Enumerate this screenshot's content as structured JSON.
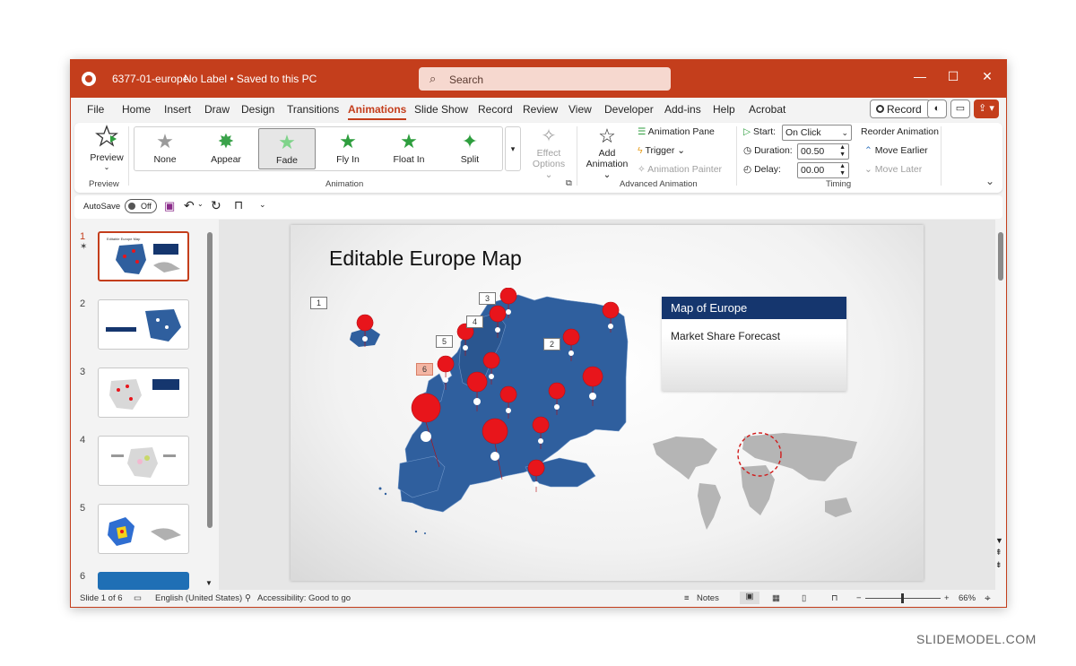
{
  "window": {
    "filename": "6377-01-europe",
    "label_status": "No Label • Saved to this PC"
  },
  "search": {
    "placeholder": "Search"
  },
  "menu": {
    "items": [
      "File",
      "Home",
      "Insert",
      "Draw",
      "Design",
      "Transitions",
      "Animations",
      "Slide Show",
      "Record",
      "Review",
      "View",
      "Developer",
      "Add-ins",
      "Help",
      "Acrobat"
    ],
    "active": "Animations"
  },
  "toolbar": {
    "record_label": "Record"
  },
  "ribbon": {
    "preview_label": "Preview",
    "preview_group": "Preview",
    "animations": [
      "None",
      "Appear",
      "Fade",
      "Fly In",
      "Float In",
      "Split"
    ],
    "selected_animation": "Fade",
    "effect_options_1": "Effect",
    "effect_options_2": "Options",
    "animation_group": "Animation",
    "add_animation_1": "Add",
    "add_animation_2": "Animation",
    "animation_pane": "Animation Pane",
    "trigger": "Trigger",
    "animation_painter": "Animation Painter",
    "advanced_group": "Advanced Animation",
    "start_label": "Start:",
    "start_value": "On Click",
    "duration_label": "Duration:",
    "duration_value": "00.50",
    "delay_label": "Delay:",
    "delay_value": "00.00",
    "timing_group": "Timing",
    "reorder_title": "Reorder Animation",
    "move_earlier": "Move Earlier",
    "move_later": "Move Later"
  },
  "qat": {
    "autosave_label": "AutoSave",
    "autosave_state": "Off"
  },
  "slides": {
    "numbers": [
      "1",
      "2",
      "3",
      "4",
      "5",
      "6"
    ],
    "thumb_title": "Editable Europe Map"
  },
  "slide": {
    "title": "Editable Europe Map",
    "box_title": "Map of Europe",
    "box_subtitle": "Market Share Forecast",
    "tags": [
      "1",
      "2",
      "3",
      "4",
      "5",
      "6"
    ]
  },
  "status": {
    "slide_info": "Slide 1 of 6",
    "language": "English (United States)",
    "accessibility": "Accessibility: Good to go",
    "notes": "Notes",
    "zoom": "66%"
  },
  "watermark": "SLIDEMODEL.COM",
  "colors": {
    "accent": "#c43e1c",
    "map_blue": "#2f5f9e",
    "pin_red": "#e8151b",
    "box_header": "#15366e"
  }
}
